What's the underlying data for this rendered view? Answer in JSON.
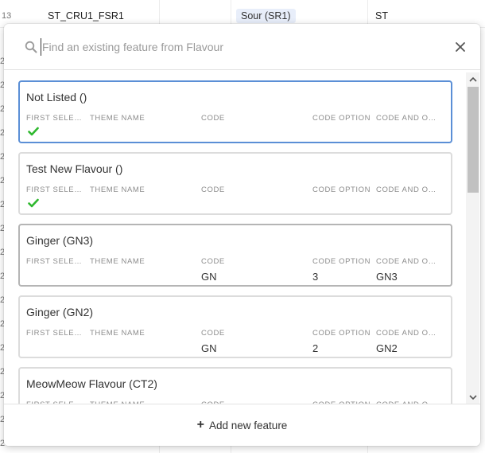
{
  "background": {
    "row_number": "13",
    "cell_a": "ST_CRU1_FSR1",
    "cell_chip": "Sour (SR1)",
    "cell_b": "ST",
    "side_numbers": [
      "2",
      "2",
      "2",
      "2",
      "2",
      "2",
      "2",
      "2",
      "2",
      "2",
      "2",
      "2",
      "2",
      "2",
      "2",
      "2",
      "2"
    ]
  },
  "search": {
    "placeholder": "Find an existing feature from Flavour",
    "value": ""
  },
  "columns": {
    "first_selected": "FIRST SELEC...",
    "theme_name": "THEME NAME",
    "code": "CODE",
    "code_option": "CODE OPTION",
    "code_and_option": "CODE AND OP..."
  },
  "features": [
    {
      "title": "Not Listed ()",
      "first_selected": true,
      "theme_name": "",
      "code": "",
      "code_option": "",
      "code_and_option": ""
    },
    {
      "title": "Test New Flavour ()",
      "first_selected": true,
      "theme_name": "",
      "code": "",
      "code_option": "",
      "code_and_option": ""
    },
    {
      "title": "Ginger (GN3)",
      "first_selected": false,
      "theme_name": "",
      "code": "GN",
      "code_option": "3",
      "code_and_option": "GN3"
    },
    {
      "title": "Ginger (GN2)",
      "first_selected": false,
      "theme_name": "",
      "code": "GN",
      "code_option": "2",
      "code_and_option": "GN2"
    },
    {
      "title": "MeowMeow Flavour (CT2)",
      "first_selected": false,
      "theme_name": "",
      "code": "",
      "code_option": "",
      "code_and_option": ""
    }
  ],
  "footer": {
    "add_label": "Add new feature",
    "add_icon": "+"
  },
  "colors": {
    "selected_border": "#5b8fd6",
    "check_green": "#2eb82e",
    "chip_bg": "#e8eefa"
  }
}
